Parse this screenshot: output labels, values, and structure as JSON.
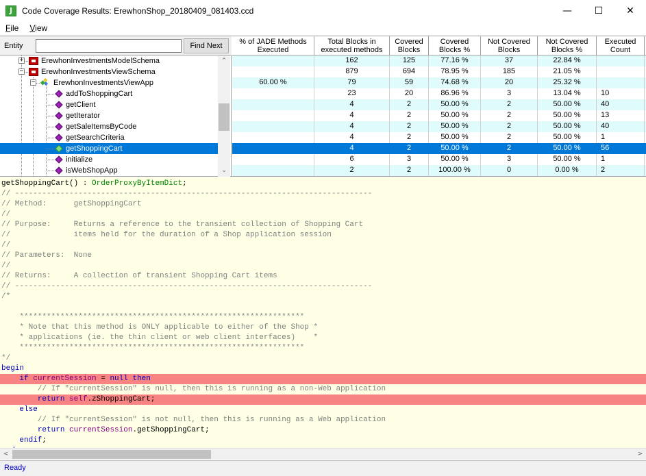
{
  "window": {
    "title": "Code Coverage Results: ErewhonShop_20180409_081403.ccd",
    "app_icon_letter": "J",
    "minimize_glyph": "—",
    "maximize_glyph": "☐",
    "close_glyph": "✕"
  },
  "menu": {
    "file_hotkey": "F",
    "file_rest": "ile",
    "view_hotkey": "V",
    "view_rest": "iew"
  },
  "entity": {
    "label": "Entity",
    "value": "",
    "find_next_label": "Find Next"
  },
  "tree": {
    "items": [
      {
        "label": "ErewhonInvestmentsModelSchema",
        "kind": "schema",
        "expander": "+"
      },
      {
        "label": "ErewhonInvestmentsViewSchema",
        "kind": "schema",
        "expander": "−"
      },
      {
        "label": "ErewhonInvestmentsViewApp",
        "kind": "application",
        "expander": "−"
      },
      {
        "label": "addToShoppingCart",
        "kind": "method"
      },
      {
        "label": "getClient",
        "kind": "method"
      },
      {
        "label": "getIterator",
        "kind": "method"
      },
      {
        "label": "getSaleItemsByCode",
        "kind": "method"
      },
      {
        "label": "getSearchCriteria",
        "kind": "method"
      },
      {
        "label": "getShoppingCart",
        "kind": "method",
        "selected": true
      },
      {
        "label": "initialize",
        "kind": "method"
      },
      {
        "label": "isWebShopApp",
        "kind": "method"
      }
    ],
    "scroll_up": "⌃",
    "scroll_down": "⌄"
  },
  "grid": {
    "headers": [
      {
        "line1": "% of JADE Methods",
        "line2": "Executed"
      },
      {
        "line1": "Total Blocks in",
        "line2": "executed methods"
      },
      {
        "line1": "Covered",
        "line2": "Blocks"
      },
      {
        "line1": "Covered",
        "line2": "Blocks %"
      },
      {
        "line1": "Not Covered",
        "line2": "Blocks"
      },
      {
        "line1": "Not Covered",
        "line2": "Blocks %"
      },
      {
        "line1": "Executed",
        "line2": "Count"
      }
    ],
    "rows": [
      {
        "pct_methods": "",
        "total": "162",
        "covered": "125",
        "covered_pct": "77.16 %",
        "not_covered": "37",
        "not_covered_pct": "22.84 %",
        "count": ""
      },
      {
        "pct_methods": "",
        "total": "879",
        "covered": "694",
        "covered_pct": "78.95 %",
        "not_covered": "185",
        "not_covered_pct": "21.05 %",
        "count": ""
      },
      {
        "pct_methods": "60.00 %",
        "total": "79",
        "covered": "59",
        "covered_pct": "74.68 %",
        "not_covered": "20",
        "not_covered_pct": "25.32 %",
        "count": ""
      },
      {
        "pct_methods": "",
        "total": "23",
        "covered": "20",
        "covered_pct": "86.96 %",
        "not_covered": "3",
        "not_covered_pct": "13.04 %",
        "count": "10"
      },
      {
        "pct_methods": "",
        "total": "4",
        "covered": "2",
        "covered_pct": "50.00 %",
        "not_covered": "2",
        "not_covered_pct": "50.00 %",
        "count": "40"
      },
      {
        "pct_methods": "",
        "total": "4",
        "covered": "2",
        "covered_pct": "50.00 %",
        "not_covered": "2",
        "not_covered_pct": "50.00 %",
        "count": "13"
      },
      {
        "pct_methods": "",
        "total": "4",
        "covered": "2",
        "covered_pct": "50.00 %",
        "not_covered": "2",
        "not_covered_pct": "50.00 %",
        "count": "40"
      },
      {
        "pct_methods": "",
        "total": "4",
        "covered": "2",
        "covered_pct": "50.00 %",
        "not_covered": "2",
        "not_covered_pct": "50.00 %",
        "count": "1"
      },
      {
        "pct_methods": "",
        "total": "4",
        "covered": "2",
        "covered_pct": "50.00 %",
        "not_covered": "2",
        "not_covered_pct": "50.00 %",
        "count": "56",
        "selected": true
      },
      {
        "pct_methods": "",
        "total": "6",
        "covered": "3",
        "covered_pct": "50.00 %",
        "not_covered": "3",
        "not_covered_pct": "50.00 %",
        "count": "1"
      },
      {
        "pct_methods": "",
        "total": "2",
        "covered": "2",
        "covered_pct": "100.00 %",
        "not_covered": "0",
        "not_covered_pct": "0.00 %",
        "count": "2"
      }
    ]
  },
  "code": {
    "lines": [
      {
        "segments": [
          {
            "t": "getShoppingCart() : ",
            "c": "black"
          },
          {
            "t": "OrderProxyByItemDict",
            "c": "type"
          },
          {
            "t": ";",
            "c": "black"
          }
        ]
      },
      {
        "segments": [
          {
            "t": "// -------------------------------------------------------------------------------",
            "c": "comment"
          }
        ]
      },
      {
        "segments": [
          {
            "t": "// Method:      getShoppingCart",
            "c": "comment"
          }
        ]
      },
      {
        "segments": [
          {
            "t": "//",
            "c": "comment"
          }
        ]
      },
      {
        "segments": [
          {
            "t": "// Purpose:     Returns a reference to the transient collection of Shopping Cart",
            "c": "comment"
          }
        ]
      },
      {
        "segments": [
          {
            "t": "//              items held for the duration of a Shop application session",
            "c": "comment"
          }
        ]
      },
      {
        "segments": [
          {
            "t": "//",
            "c": "comment"
          }
        ]
      },
      {
        "segments": [
          {
            "t": "// Parameters:  None",
            "c": "comment"
          }
        ]
      },
      {
        "segments": [
          {
            "t": "//",
            "c": "comment"
          }
        ]
      },
      {
        "segments": [
          {
            "t": "// Returns:     A collection of transient Shopping Cart items",
            "c": "comment"
          }
        ]
      },
      {
        "segments": [
          {
            "t": "// -------------------------------------------------------------------------------",
            "c": "comment"
          }
        ]
      },
      {
        "segments": [
          {
            "t": "/*",
            "c": "comment"
          }
        ]
      },
      {
        "segments": [
          {
            "t": "",
            "c": "comment"
          }
        ]
      },
      {
        "segments": [
          {
            "t": "    ***************************************************************",
            "c": "comment"
          }
        ]
      },
      {
        "segments": [
          {
            "t": "    * Note that this method is ONLY applicable to either of the Shop *",
            "c": "comment"
          }
        ]
      },
      {
        "segments": [
          {
            "t": "    * applications (ie. the thin client or web client interfaces)    *",
            "c": "comment"
          }
        ]
      },
      {
        "segments": [
          {
            "t": "    ***************************************************************",
            "c": "comment"
          }
        ]
      },
      {
        "segments": [
          {
            "t": "*/",
            "c": "comment"
          }
        ]
      },
      {
        "segments": [
          {
            "t": "begin",
            "c": "kw"
          }
        ]
      },
      {
        "hl": true,
        "segments": [
          {
            "t": "    ",
            "c": "black"
          },
          {
            "t": "if",
            "c": "kw"
          },
          {
            "t": " ",
            "c": "black"
          },
          {
            "t": "currentSession",
            "c": "var"
          },
          {
            "t": " = ",
            "c": "black"
          },
          {
            "t": "null",
            "c": "kw"
          },
          {
            "t": " ",
            "c": "black"
          },
          {
            "t": "then",
            "c": "kw"
          }
        ]
      },
      {
        "segments": [
          {
            "t": "        // If \"currentSession\" is null, then this is running as a non-Web application",
            "c": "comment"
          }
        ]
      },
      {
        "hl": true,
        "segments": [
          {
            "t": "        ",
            "c": "black"
          },
          {
            "t": "return",
            "c": "kw"
          },
          {
            "t": " ",
            "c": "black"
          },
          {
            "t": "self",
            "c": "var"
          },
          {
            "t": ".zShoppingCart;",
            "c": "black"
          }
        ]
      },
      {
        "segments": [
          {
            "t": "    ",
            "c": "black"
          },
          {
            "t": "else",
            "c": "kw"
          }
        ]
      },
      {
        "segments": [
          {
            "t": "        // If \"currentSession\" is not null, then this is running as a Web application",
            "c": "comment"
          }
        ]
      },
      {
        "segments": [
          {
            "t": "        ",
            "c": "black"
          },
          {
            "t": "return",
            "c": "kw"
          },
          {
            "t": " ",
            "c": "black"
          },
          {
            "t": "currentSession",
            "c": "var"
          },
          {
            "t": ".getShoppingCart;",
            "c": "black"
          }
        ]
      },
      {
        "segments": [
          {
            "t": "    ",
            "c": "black"
          },
          {
            "t": "endif",
            "c": "kw"
          },
          {
            "t": ";",
            "c": "black"
          }
        ]
      },
      {
        "segments": [
          {
            "t": "end",
            "c": "kw"
          },
          {
            "t": ";",
            "c": "black"
          }
        ]
      }
    ]
  },
  "hscroll": {
    "left": "<",
    "right": ">"
  },
  "status": {
    "text": "Ready"
  }
}
